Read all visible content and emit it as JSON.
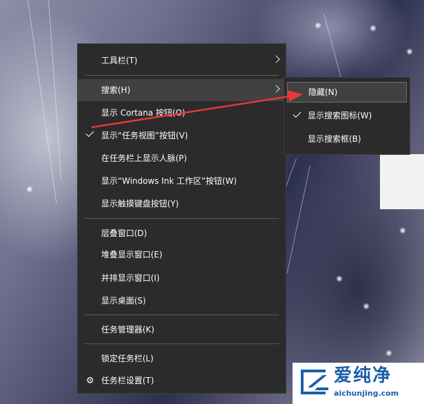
{
  "menu": {
    "items": [
      {
        "label": "工具栏(T)",
        "submenu": true
      },
      {
        "label": "搜索(H)",
        "submenu": true,
        "highlighted": true
      },
      {
        "label": "显示 Cortana 按钮(O)"
      },
      {
        "label": "显示“任务视图”按钮(V)",
        "checked": true
      },
      {
        "label": "在任务栏上显示人脉(P)"
      },
      {
        "label": "显示“Windows Ink 工作区”按钮(W)"
      },
      {
        "label": "显示触摸键盘按钮(Y)"
      },
      {
        "label": "层叠窗口(D)"
      },
      {
        "label": "堆叠显示窗口(E)"
      },
      {
        "label": "并排显示窗口(I)"
      },
      {
        "label": "显示桌面(S)"
      },
      {
        "label": "任务管理器(K)"
      },
      {
        "label": "锁定任务栏(L)"
      },
      {
        "label": "任务栏设置(T)",
        "icon": "gear-icon"
      }
    ]
  },
  "submenu": {
    "items": [
      {
        "label": "隐藏(N)",
        "highlighted": true
      },
      {
        "label": "显示搜索图标(W)",
        "checked": true
      },
      {
        "label": "显示搜索框(B)"
      }
    ]
  },
  "watermark": {
    "text": "爱纯净",
    "url": "aichunjing.com"
  },
  "colors": {
    "menu_bg": "#2b2b2b",
    "menu_hover": "#414141",
    "annotation_arrow": "#e53935",
    "watermark_blue": "#1a5fa8"
  }
}
